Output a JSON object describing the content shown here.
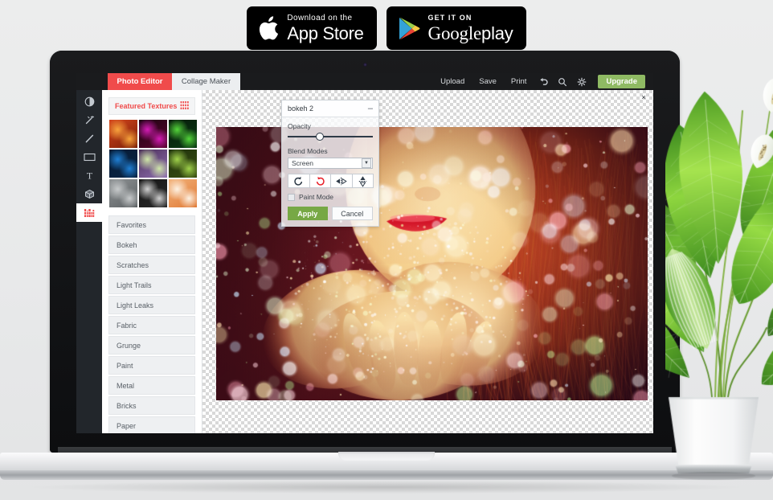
{
  "badges": {
    "app_store": {
      "small": "Download on the",
      "big": "App Store",
      "icon": "apple-icon"
    },
    "google_play": {
      "small": "GET IT ON",
      "big": "Google",
      "big_thin": "play",
      "icon": "google-play-icon"
    }
  },
  "app": {
    "tabs": [
      {
        "label": "Photo Editor",
        "active": true
      },
      {
        "label": "Collage Maker",
        "active": false
      }
    ],
    "toolbar": {
      "upload": "Upload",
      "save": "Save",
      "print": "Print",
      "undo_icon": "undo-arrow-icon",
      "zoom_icon": "magnifier-icon",
      "settings_icon": "gear-icon",
      "upgrade": "Upgrade",
      "upgrade_color": "#8fba63"
    },
    "close_button": "×",
    "rail": [
      {
        "icon": "contrast-adjust-icon",
        "active": false
      },
      {
        "icon": "magic-wand-icon",
        "active": false
      },
      {
        "icon": "brush-icon",
        "active": false
      },
      {
        "icon": "frame-crop-icon",
        "active": false
      },
      {
        "icon": "text-tool-icon",
        "active": false
      },
      {
        "icon": "cube-3d-icon",
        "active": false
      },
      {
        "icon": "textures-grid-icon",
        "active": true
      }
    ],
    "textures": {
      "featured_label": "Featured Textures",
      "featured_icon": "sliders-icon",
      "accent_color": "#f04b4b",
      "thumbnails": [
        {
          "name": "bokeh-orange",
          "c1": "#d4451d",
          "c2": "#f7a33c",
          "c3": "#7a1f06"
        },
        {
          "name": "bokeh-magenta",
          "c1": "#1a0310",
          "c2": "#d31bb5",
          "c3": "#5c0530"
        },
        {
          "name": "light-trails-green",
          "c1": "#06180a",
          "c2": "#53d43a",
          "c3": "#0b3d14"
        },
        {
          "name": "light-trails-blue",
          "c1": "#061a33",
          "c2": "#1f7fd4",
          "c3": "#0a2647"
        },
        {
          "name": "light-leak-pastel",
          "c1": "#4a2e58",
          "c2": "#cfe6a8",
          "c3": "#8f6fb0"
        },
        {
          "name": "light-leak-warm",
          "c1": "#1d2f0c",
          "c2": "#9fd14a",
          "c3": "#3a4f12"
        },
        {
          "name": "grunge-concrete",
          "c1": "#8e9294",
          "c2": "#c7cacb",
          "c3": "#5d6264"
        },
        {
          "name": "metal-radial",
          "c1": "#141414",
          "c2": "#cfcfcf",
          "c3": "#2a2a2a"
        },
        {
          "name": "paper-orange",
          "c1": "#f2b27a",
          "c2": "#fdf1e2",
          "c3": "#e07a36"
        }
      ],
      "categories": [
        "Favorites",
        "Bokeh",
        "Scratches",
        "Light Trails",
        "Light Leaks",
        "Fabric",
        "Grunge",
        "Paint",
        "Metal",
        "Bricks",
        "Paper"
      ]
    },
    "panel": {
      "title": "bokeh 2",
      "minimize": "–",
      "opacity_label": "Opacity",
      "opacity_value": 38,
      "blend_label": "Blend Modes",
      "blend_value": "Screen",
      "dropdown_arrow": "▼",
      "buttons": [
        {
          "name": "rotate-left-icon",
          "color": "#2e3a47"
        },
        {
          "name": "rotate-right-icon",
          "color": "#e8212a"
        },
        {
          "name": "flip-horizontal-icon",
          "color": "#2e3a47"
        },
        {
          "name": "flip-vertical-icon",
          "color": "#2e3a47"
        }
      ],
      "paint_mode_label": "Paint Mode",
      "paint_mode_checked": false,
      "apply_label": "Apply",
      "cancel_label": "Cancel",
      "apply_color": "#77a845"
    },
    "canvas": {
      "image_description": "woman-blowing-glitter-bokeh-overlay"
    }
  },
  "scene": {
    "plant_description": "peace-lily-in-white-pot",
    "laptop_description": "silver-laptop-open"
  }
}
